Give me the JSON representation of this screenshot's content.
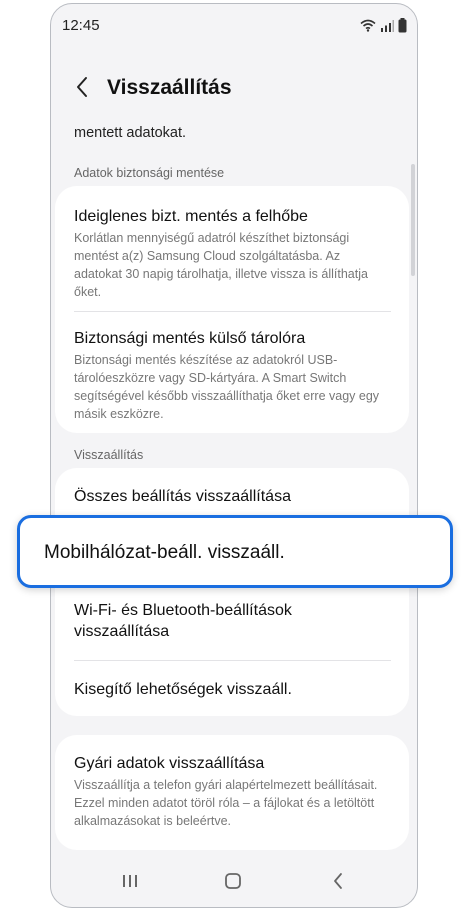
{
  "status": {
    "time": "12:45"
  },
  "header": {
    "title": "Visszaállítás"
  },
  "scroll_text": "mentett adatokat.",
  "sections": [
    {
      "label": "Adatok biztonsági mentése",
      "items": [
        {
          "title": "Ideiglenes bizt. mentés a felhőbe",
          "desc": "Korlátlan mennyiségű adatról készíthet biztonsági mentést a(z) Samsung Cloud szolgáltatásba. Az adatokat 30 napig tárolhatja, illetve vissza is állíthatja őket."
        },
        {
          "title": "Biztonsági mentés külső tárolóra",
          "desc": "Biztonsági mentés készítése az adatokról USB-tárolóeszközre vagy SD-kártyára. A Smart Switch segítségével később visszaállíthatja őket erre vagy egy másik eszközre."
        }
      ]
    },
    {
      "label": "Visszaállítás",
      "items": [
        {
          "title": "Összes beállítás visszaállítása"
        },
        {
          "title": "Wi-Fi- és Bluetooth-beállítások visszaállítása"
        },
        {
          "title": "Kisegítő lehetőségek visszaáll."
        }
      ]
    }
  ],
  "factory": {
    "title": "Gyári adatok visszaállítása",
    "desc": "Visszaállítja a telefon gyári alapértelmezett beállításait. Ezzel minden adatot töröl róla – a fájlokat és a letöltött alkalmazásokat is beleértve."
  },
  "highlight": {
    "label": "Mobilhálózat-beáll. visszaáll."
  },
  "icons": {
    "wifi": "wifi-icon",
    "signal": "signal-icon",
    "battery": "battery-icon",
    "back": "chevron-left-icon",
    "recents": "recents-icon",
    "home": "home-icon",
    "nav_back": "nav-back-icon"
  },
  "colors": {
    "highlight_border": "#1a6ee0",
    "background": "#f4f4f6",
    "card": "#ffffff"
  }
}
